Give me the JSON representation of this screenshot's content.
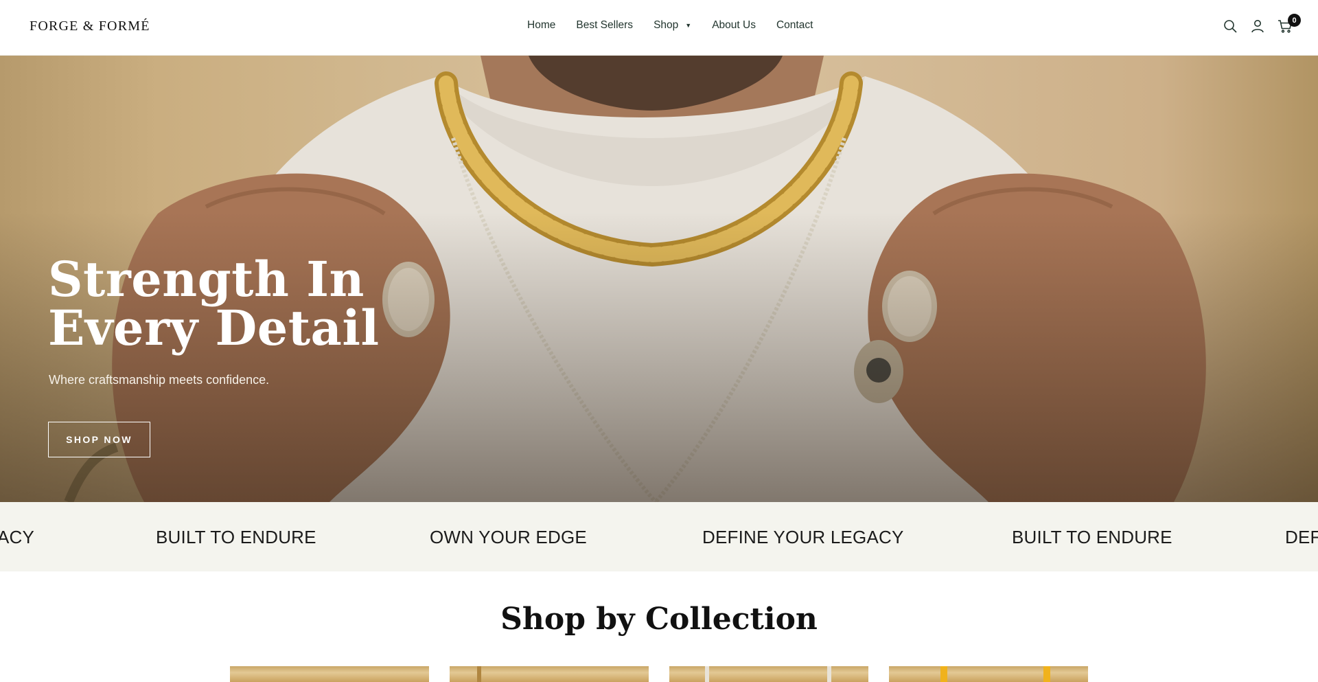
{
  "header": {
    "logo": "FORGE & FORMÉ",
    "nav": [
      {
        "label": "Home"
      },
      {
        "label": "Best Sellers"
      },
      {
        "label": "Shop",
        "has_dropdown": true
      },
      {
        "label": "About Us"
      },
      {
        "label": "Contact"
      }
    ],
    "icons": [
      "search-icon",
      "account-icon",
      "cart-icon"
    ],
    "cart_count": "0"
  },
  "hero": {
    "title_line1": "Strength In",
    "title_line2": "Every Detail",
    "subtitle": "Where craftsmanship meets confidence.",
    "button_label": "SHOP NOW"
  },
  "marquee": {
    "items": [
      "ACY",
      "BUILT TO ENDURE",
      "OWN YOUR EDGE",
      "DEFINE YOUR LEGACY",
      "BUILT TO ENDURE",
      "DEF"
    ]
  },
  "collections": {
    "title": "Shop by Collection",
    "card_count_visible": 4
  },
  "colors": {
    "header_bg": "#ffffff",
    "marquee_bg": "#f4f4ee",
    "text_dark": "#111111",
    "gold": "#c9a666"
  }
}
